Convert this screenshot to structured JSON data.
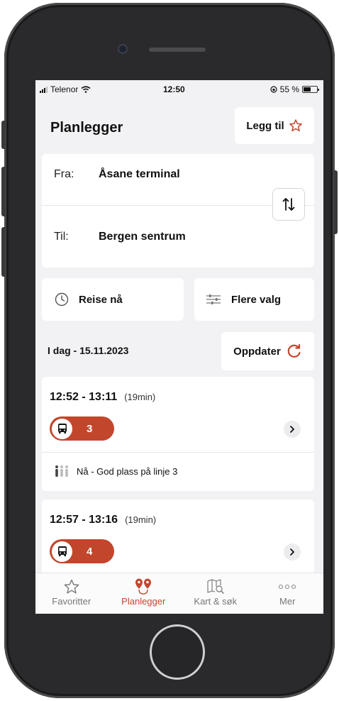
{
  "status_bar": {
    "carrier": "Telenor",
    "time": "12:50",
    "battery": "55 %"
  },
  "header": {
    "title": "Planlegger",
    "add_label": "Legg til"
  },
  "route": {
    "from_label": "Fra:",
    "from_value": "Åsane terminal",
    "to_label": "Til:",
    "to_value": "Bergen sentrum"
  },
  "options": {
    "travel_label": "Reise nå",
    "more_label": "Flere valg"
  },
  "results": {
    "date": "I dag - 15.11.2023",
    "refresh_label": "Oppdater",
    "trips": [
      {
        "time": "12:52 - 13:11",
        "duration": "(19min)",
        "line": "3",
        "crowd": "Nå - God plass på linje 3"
      },
      {
        "time": "12:57 - 13:16",
        "duration": "(19min)",
        "line": "4"
      }
    ]
  },
  "tabbar": {
    "items": [
      {
        "label": "Favoritter",
        "icon": "star-outline-icon"
      },
      {
        "label": "Planlegger",
        "icon": "route-pins-icon",
        "active": true
      },
      {
        "label": "Kart & søk",
        "icon": "map-search-icon"
      },
      {
        "label": "Mer",
        "icon": "more-dots-icon"
      }
    ]
  },
  "colors": {
    "accent": "#c2462c",
    "screen_bg": "#f2f2f4",
    "card_bg": "#ffffff"
  }
}
